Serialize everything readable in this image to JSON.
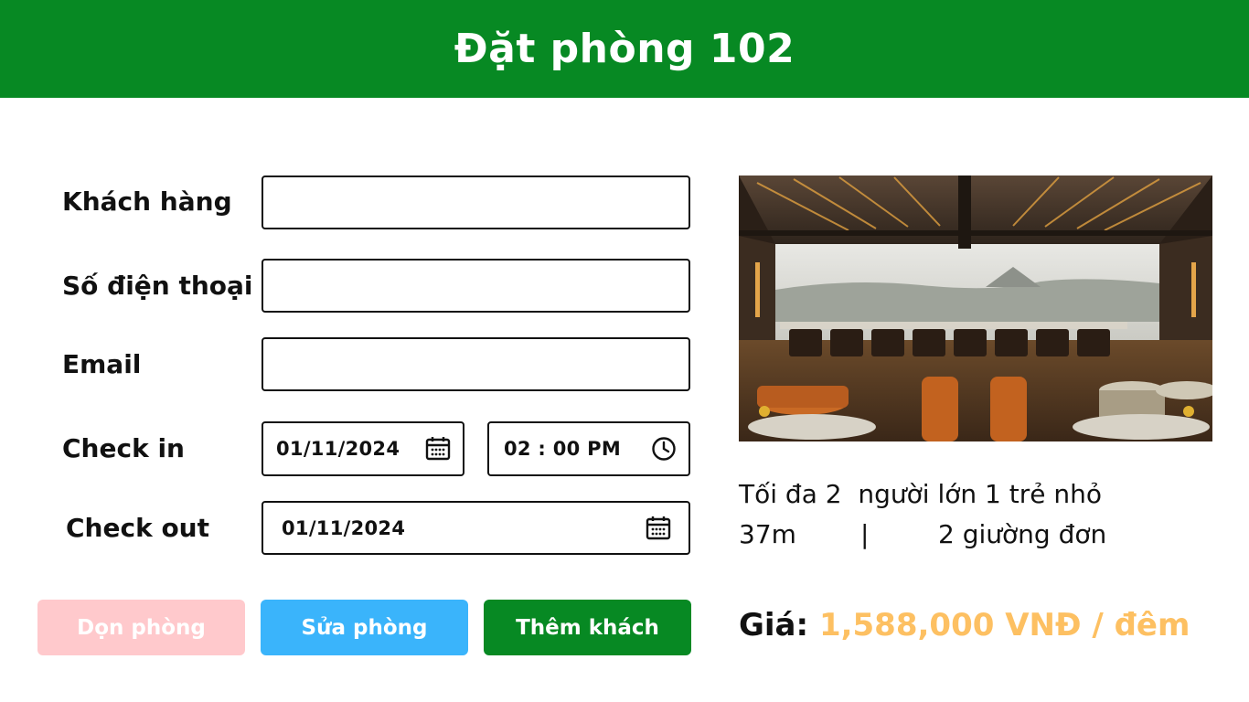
{
  "header": {
    "title": "Đặt phòng 102",
    "bg_color": "#078923"
  },
  "form": {
    "customer_label": "Khách hàng",
    "customer_value": "",
    "phone_label": "Số điện thoại",
    "phone_value": "",
    "email_label": "Email",
    "email_value": "",
    "checkin_label": "Check in",
    "checkin_date": "01/11/2024",
    "checkin_time": "02 : 00 PM",
    "checkout_label": "Check out",
    "checkout_date": "01/11/2024"
  },
  "buttons": {
    "clean": {
      "label": "Dọn phòng",
      "color": "#ffc9cc"
    },
    "edit": {
      "label": "Sửa phòng",
      "color": "#3ab4fb"
    },
    "add_guest": {
      "label": "Thêm khách",
      "color": "#078923"
    }
  },
  "room": {
    "capacity": "Tối đa 2  người lớn 1 trẻ nhỏ",
    "size": "37m",
    "separator": "|",
    "beds": "2 giường đơn",
    "price_label": "Giá:",
    "price_value": "1,588,000 VNĐ / đêm",
    "price_color": "#fdc062"
  },
  "icons": {
    "date": "calendar-icon",
    "time": "clock-icon"
  }
}
